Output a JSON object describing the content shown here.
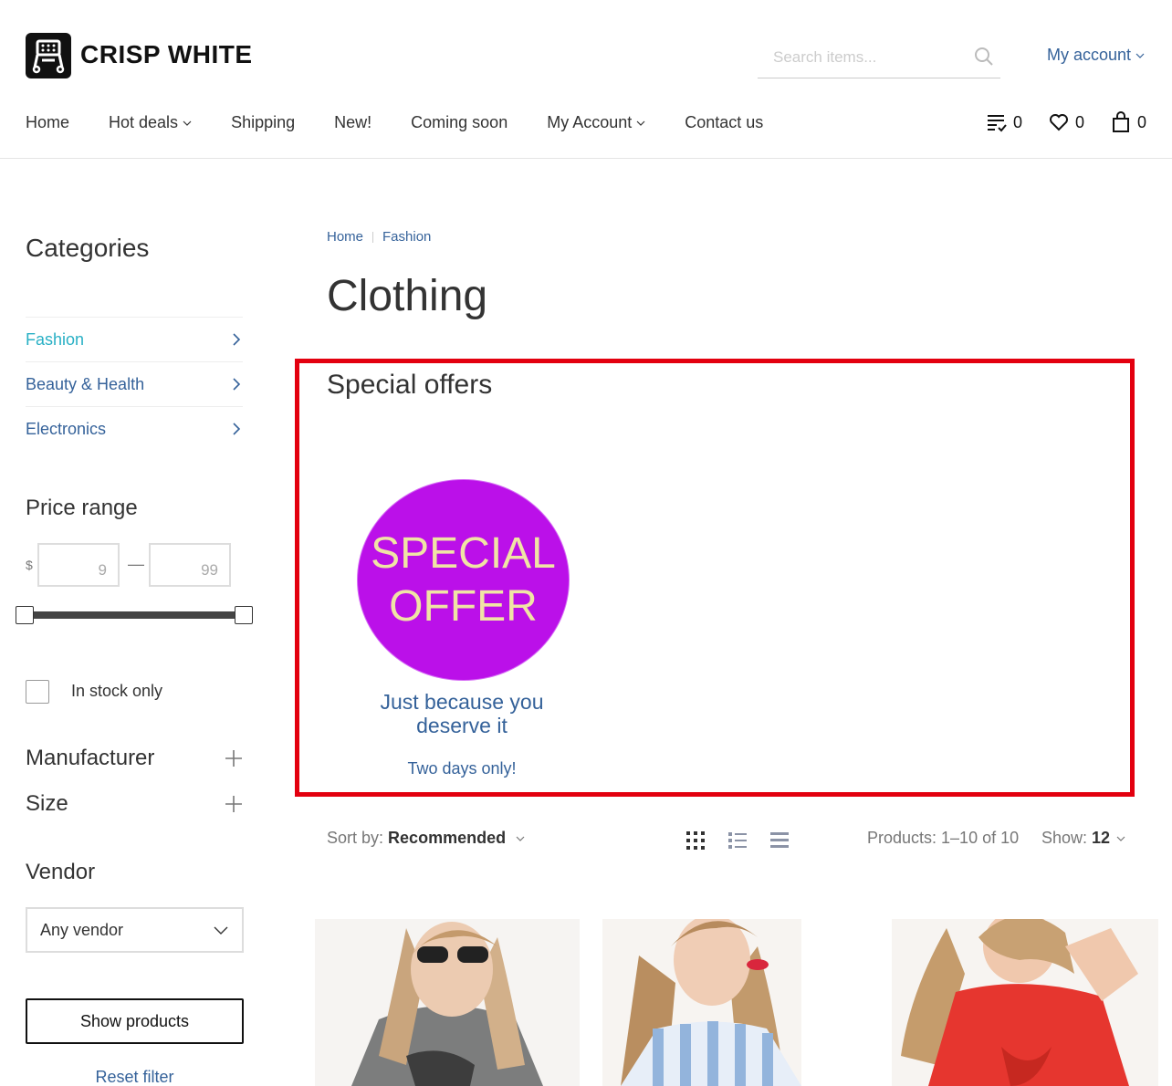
{
  "brand": {
    "name": "CRISP WHITE"
  },
  "search": {
    "placeholder": "Search items..."
  },
  "account_link": "My account",
  "nav": [
    "Home",
    "Hot deals",
    "Shipping",
    "New!",
    "Coming soon",
    "My Account",
    "Contact us"
  ],
  "header_counts": {
    "compare": "0",
    "wishlist": "0",
    "cart": "0"
  },
  "sidebar": {
    "categories_title": "Categories",
    "categories": [
      "Fashion",
      "Beauty & Health",
      "Electronics"
    ],
    "price_title": "Price range",
    "currency": "$",
    "price_min": "9",
    "price_max": "99",
    "price_dash": "—",
    "in_stock_label": "In stock only",
    "manufacturer_label": "Manufacturer",
    "size_label": "Size",
    "vendor_title": "Vendor",
    "vendor_selected": "Any vendor",
    "show_button": "Show products",
    "reset_link": "Reset filter"
  },
  "breadcrumb": [
    "Home",
    "Fashion"
  ],
  "page_title": "Clothing",
  "special_offers": {
    "title": "Special offers",
    "badge_line1": "SPECIAL",
    "badge_line2": "OFFER",
    "tagline": "Just because you deserve it",
    "subline": "Two days only!"
  },
  "sort": {
    "label": "Sort by:",
    "value": "Recommended"
  },
  "products_count": "Products: 1–10 of 10",
  "show": {
    "label": "Show:",
    "value": "12"
  },
  "colors": {
    "accent": "#29b0c5",
    "link": "#35629a",
    "highlight_border": "#e3000f",
    "offer_bg": "#bb10e9",
    "offer_text": "#f0e4a5"
  }
}
